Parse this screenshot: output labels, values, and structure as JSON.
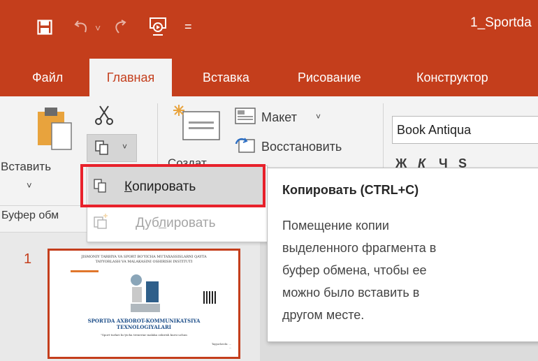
{
  "window": {
    "title": "1_Sportda"
  },
  "quick_access": {
    "icons": [
      "save-icon",
      "undo-icon",
      "redo-icon",
      "presentation-icon",
      "customize-icon"
    ],
    "undo_chevron": "˅",
    "customize": "="
  },
  "tabs": [
    {
      "label": "Файл"
    },
    {
      "label": "Главная"
    },
    {
      "label": "Вставка"
    },
    {
      "label": "Рисование"
    },
    {
      "label": "Конструктор"
    }
  ],
  "ribbon": {
    "paste_label": "Вставить",
    "paste_chevron": "˅",
    "clipboard_group": "Буфер обм",
    "new_slide_partial": "Создат",
    "layout_label": "Макет",
    "layout_chevron": "˅",
    "reset_label": "Восстановить",
    "font_name": "Book Antiqua",
    "bold": "Ж",
    "italic": "К",
    "underline": "Ч",
    "strike": "S"
  },
  "copy_menu": {
    "copy_label_before": "",
    "copy_label_u": "К",
    "copy_label_after": "опировать",
    "dup_before": "Дуб",
    "dup_u": "л",
    "dup_after": "ировать"
  },
  "tooltip": {
    "title": "Копировать (CTRL+C)",
    "lines": [
      "Помещение копии",
      "выделенного фрагмента в",
      "буфер обмена, чтобы ее",
      "можно было вставить в",
      "другом месте."
    ]
  },
  "slides": {
    "number": "1",
    "header_line1": "JISMONIY TARBIYA VA SPORT BO'YICHA MUTAXASSISLARNI QAYTA",
    "header_line2": "TAYYORLASH VA MALAKASINI OSHIRISH INSTITUTI",
    "title_line1": "SPORTDA AXBOROT-KOMMUNIKATSIYA",
    "title_line2": "TEXNOLOGIYALARI",
    "subtitle": "\"Sport turlari bo'yicha treneriar malaka oshirish kursi uchun",
    "footer_line1": "Tayyorlovchi: ...",
    "footer_line2": "..."
  },
  "colors": {
    "accent": "#c43e1c",
    "highlight": "#e8212b"
  }
}
